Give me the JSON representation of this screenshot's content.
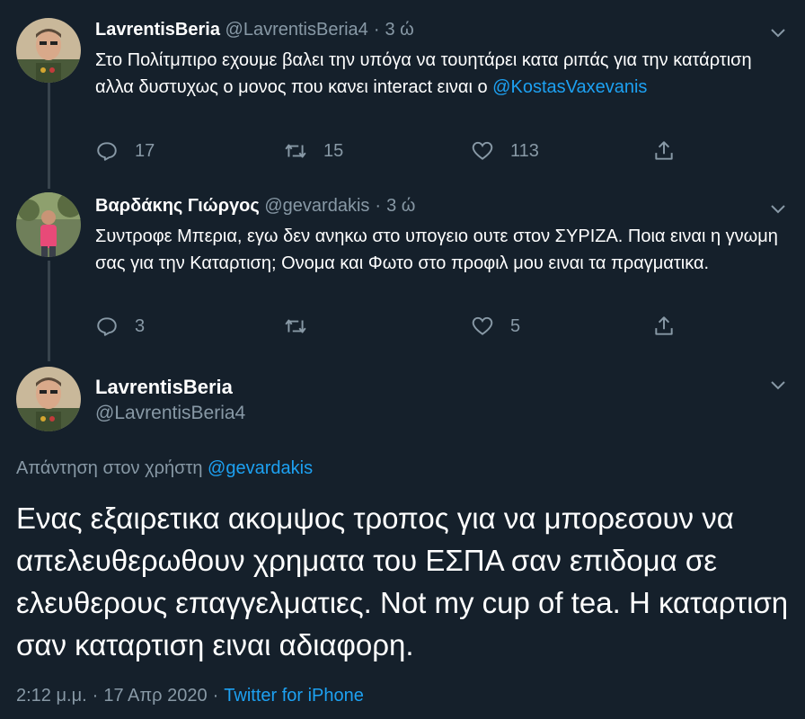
{
  "tweets": [
    {
      "display_name": "LavrentisBeria",
      "handle": "@LavrentisBeria4",
      "time": "3 ώ",
      "text_prefix": "Στο Πολίτμπιρο εχουμε βαλει την υπόγα να τουητάρει κατα ριπάς για την κατάρτιση αλλα δυστυχως ο μονος που κανει interact ειναι ο ",
      "mention": "@KostasVaxevanis",
      "replies": "17",
      "retweets": "15",
      "likes": "113"
    },
    {
      "display_name": "Βαρδάκης Γιώργος",
      "handle": "@gevardakis",
      "time": "3 ώ",
      "text": "Συντροφε Μπερια, εγω δεν ανηκω στο υπογειο ουτε στον ΣΥΡΙΖΑ. Ποια ειναι η γνωμη σας για την Καταρτιση; Ονομα και Φωτο στο προφιλ μου ειναι τα πραγματικα.",
      "replies": "3",
      "retweets": "",
      "likes": "5"
    }
  ],
  "main_tweet": {
    "display_name": "LavrentisBeria",
    "handle": "@LavrentisBeria4",
    "reply_label": "Απάντηση στον χρήστη",
    "reply_mention": "@gevardakis",
    "text": "Ενας εξαιρετικα ακομψος τροπος για να μπορεσουν να απελευθερωθουν χρηματα του ΕΣΠΑ σαν επιδομα σε ελευθερους επαγγελματιες. Not my cup of tea. Η καταρτιση σαν καταρτιση ειναι αδιαφορη.",
    "time": "2:12 μ.μ.",
    "date": "17 Απρ 2020",
    "source": "Twitter for iPhone"
  },
  "icons": {
    "reply": "reply-icon",
    "retweet": "retweet-icon",
    "like": "heart-icon",
    "share": "share-icon",
    "caret": "chevron-down-icon"
  },
  "colors": {
    "background": "#15202b",
    "muted": "#8899a6",
    "link": "#1da1f2",
    "divider": "#38444d"
  }
}
